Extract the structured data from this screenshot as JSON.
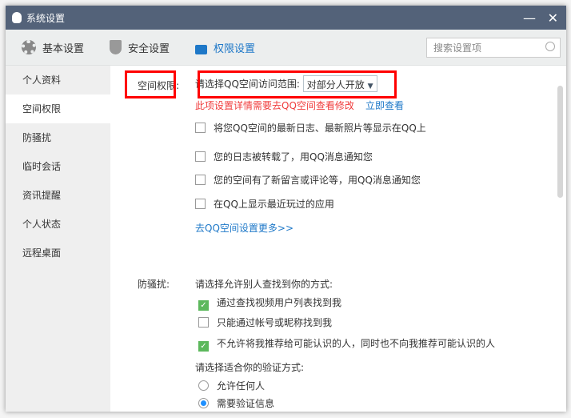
{
  "window": {
    "title": "系统设置",
    "minimize": "—",
    "close": "✕"
  },
  "tabs": [
    {
      "label": "基本设置",
      "icon": "gear-icon"
    },
    {
      "label": "安全设置",
      "icon": "shield-icon"
    },
    {
      "label": "权限设置",
      "icon": "lock-icon"
    }
  ],
  "search": {
    "placeholder": "搜索设置项"
  },
  "sidebar": {
    "items": [
      "个人资料",
      "空间权限",
      "防骚扰",
      "临时会话",
      "资讯提醒",
      "个人状态",
      "远程桌面"
    ]
  },
  "space": {
    "label": "空间权限:",
    "range_label": "请选择QQ空间访问范围:",
    "range_value": "对部分人开放",
    "note": "此项设置详情需要去QQ空间查看修改",
    "view_link": "立即查看",
    "options": [
      "将您QQ空间的最新日志、最新照片等显示在QQ上",
      "您的日志被转载了，用QQ消息通知您",
      "您的空间有了新留言或评论等，用QQ消息通知您",
      "在QQ上显示最近玩过的应用"
    ],
    "more_link": "去QQ空间设置更多>>"
  },
  "harass": {
    "label": "防骚扰:",
    "find_label": "请选择允许别人查找到你的方式:",
    "find_options": [
      {
        "text": "通过查找视频用户列表找到我",
        "checked": true
      },
      {
        "text": "只能通过帐号或昵称找到我",
        "checked": false
      },
      {
        "text": "不允许将我推荐给可能认识的人，同时也不向我推荐可能认识的人",
        "checked": true
      }
    ],
    "verify_label": "请选择适合你的验证方式:",
    "verify_options": [
      {
        "text": "允许任何人",
        "selected": false
      },
      {
        "text": "需要验证信息",
        "selected": true
      }
    ]
  }
}
